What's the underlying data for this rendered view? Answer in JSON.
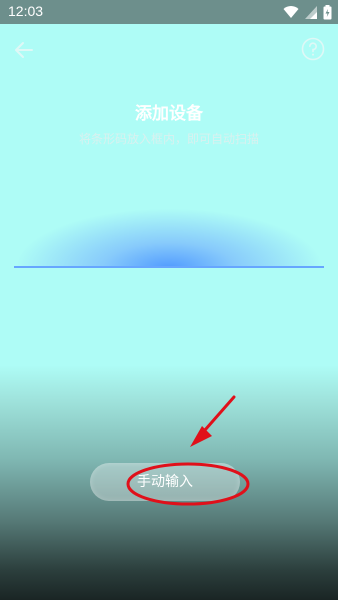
{
  "status_bar": {
    "time": "12:03",
    "icons": [
      "wifi-icon",
      "signal-icon",
      "battery-icon"
    ]
  },
  "header": {
    "back_icon": "arrow-left-icon",
    "help_icon": "help-circle-icon"
  },
  "main": {
    "title": "添加设备",
    "hint": "将条形码放入框内，即可自动扫描",
    "manual_input_label": "手动输入"
  },
  "colors": {
    "background_top": "#aefcf6",
    "background_bottom": "#1a2524",
    "status_bar": "#6d8f8c",
    "scan_glow": "#66a6ff",
    "annotation_red": "#e0101a"
  }
}
